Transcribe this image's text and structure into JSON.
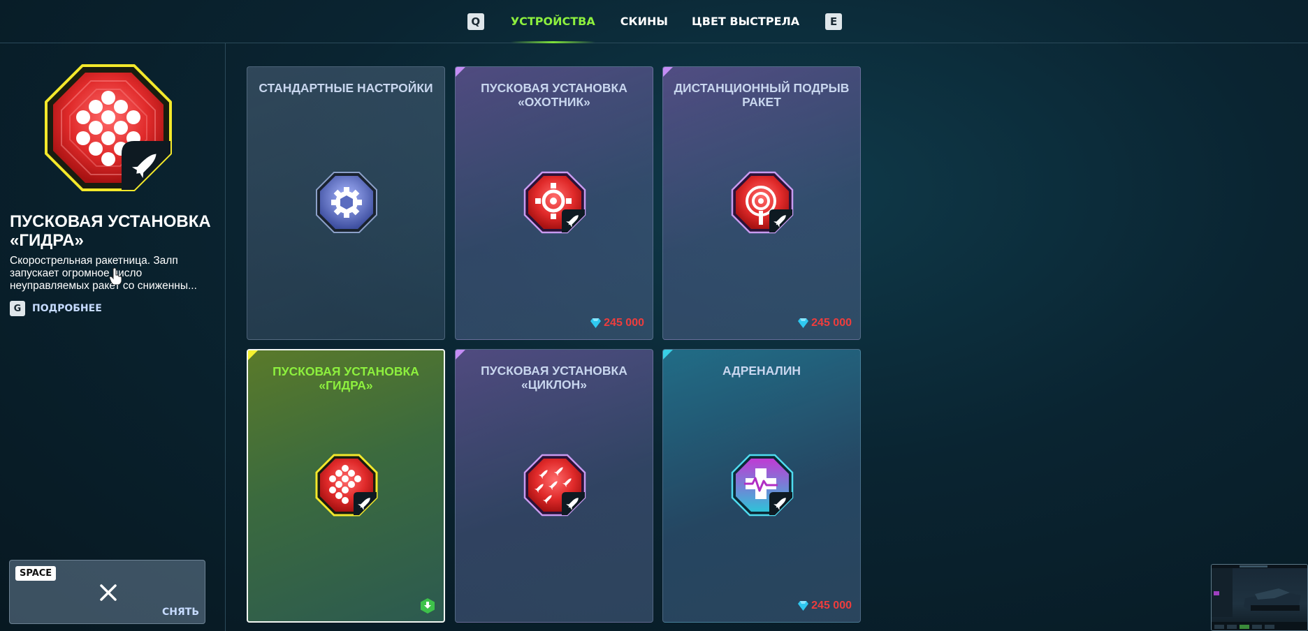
{
  "topbar": {
    "prev_key": "Q",
    "next_key": "E",
    "tabs": [
      {
        "label": "УСТРОЙСТВА",
        "active": true
      },
      {
        "label": "СКИНЫ",
        "active": false
      },
      {
        "label": "ЦВЕТ ВЫСТРЕЛА",
        "active": false
      }
    ]
  },
  "selected_item": {
    "title": "ПУСКОВАЯ УСТАНОВКА «ГИДРА»",
    "description": "Скорострельная ракетница. Залп запускает огромное число неуправляемых ракет со сниженны...",
    "more_key": "G",
    "more_label": "ПОДРОБНЕЕ",
    "icon": "hydra-launcher-icon"
  },
  "remove": {
    "key": "SPACE",
    "label": "СНЯТЬ"
  },
  "cards": [
    {
      "title": "СТАНДАРТНЫЕ НАСТРОЙКИ",
      "price": "",
      "rarity": "none",
      "icon": "default-settings-icon"
    },
    {
      "title": "ПУСКОВАЯ УСТАНОВКА «ОХОТНИК»",
      "price": "245 000",
      "rarity": "purple",
      "icon": "hunter-launcher-icon"
    },
    {
      "title": "ДИСТАНЦИОННЫЙ ПОДРЫВ РАКЕТ",
      "price": "245 000",
      "rarity": "purple",
      "icon": "remote-detonation-icon"
    },
    {
      "title": "ПУСКОВАЯ УСТАНОВКА «ГИДРА»",
      "price": "",
      "rarity": "yellow",
      "icon": "hydra-launcher-icon",
      "equipped": true
    },
    {
      "title": "ПУСКОВАЯ УСТАНОВКА «ЦИКЛОН»",
      "price": "",
      "rarity": "purple",
      "icon": "cyclone-launcher-icon"
    },
    {
      "title": "АДРЕНАЛИН",
      "price": "245 000",
      "rarity": "cyan",
      "icon": "adrenaline-icon"
    }
  ],
  "colors": {
    "accent_green": "#8df03e",
    "price_red": "#ef3d3d",
    "crystal_cyan": "#2fc8f0"
  }
}
